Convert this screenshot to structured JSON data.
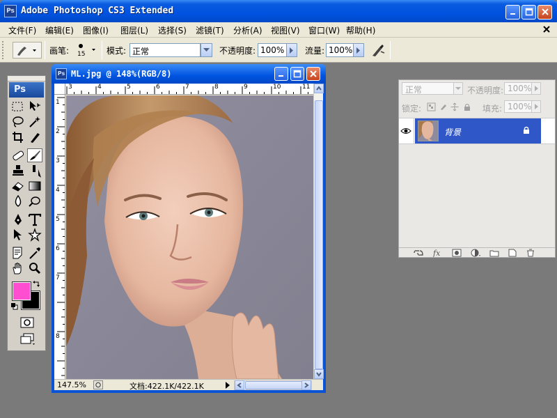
{
  "window": {
    "icon_text": "Ps",
    "title": "Adobe Photoshop CS3 Extended"
  },
  "menu": [
    {
      "label": "文件(F)"
    },
    {
      "label": "编辑(E)"
    },
    {
      "label": "图像(I)"
    },
    {
      "label": "图层(L)"
    },
    {
      "label": "选择(S)"
    },
    {
      "label": "滤镜(T)"
    },
    {
      "label": "分析(A)"
    },
    {
      "label": "视图(V)"
    },
    {
      "label": "窗口(W)"
    },
    {
      "label": "帮助(H)"
    }
  ],
  "options": {
    "brush_label": "画笔:",
    "brush_size": "15",
    "mode_label": "模式:",
    "mode_value": "正常",
    "opacity_label": "不透明度:",
    "opacity_value": "100%",
    "flow_label": "流量:",
    "flow_value": "100%"
  },
  "toolbox": {
    "logo": "Ps",
    "tools": [
      "marquee-icon",
      "move-icon",
      "lasso-icon",
      "magic-wand-icon",
      "crop-icon",
      "slice-icon",
      "healing-brush-icon",
      "brush-icon",
      "stamp-icon",
      "history-brush-icon",
      "eraser-icon",
      "gradient-icon",
      "blur-icon",
      "dodge-icon",
      "pen-icon",
      "type-icon",
      "path-select-icon",
      "shape-icon",
      "notes-icon",
      "eyedropper-icon",
      "hand-icon",
      "zoom-icon"
    ],
    "active_tool": "brush-icon",
    "foreground_color": "#ff4fd0",
    "background_color": "#000000"
  },
  "document": {
    "icon_text": "Ps",
    "title": "ML.jpg @ 148%(RGB/8)",
    "zoom": "147.5%",
    "doc_size": "文档:422.1K/422.1K",
    "ruler_top": [
      "3",
      "4",
      "5",
      "6",
      "7",
      "8",
      "9",
      "10",
      "11"
    ],
    "ruler_left": [
      "1",
      "2",
      "3",
      "4",
      "5",
      "6",
      "7",
      "8"
    ]
  },
  "layers": {
    "blend_mode": "正常",
    "opacity_label": "不透明度:",
    "opacity_value": "100%",
    "lock_label": "锁定:",
    "fill_label": "填充:",
    "fill_value": "100%",
    "items": [
      {
        "name": "背景",
        "visible": true,
        "locked": true,
        "selected": true
      }
    ]
  },
  "colors": {
    "title_blue": "#0053e0",
    "layer_selected": "#2f57c8",
    "workspace_gray": "#7a7a7a"
  }
}
